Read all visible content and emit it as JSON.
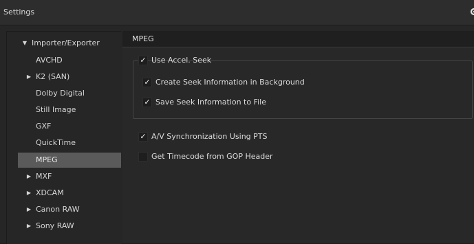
{
  "window": {
    "title": "Settings",
    "settings_icon": "gear-icon"
  },
  "tree": {
    "items": [
      {
        "label": "Importer/Exporter",
        "expandable": true,
        "expanded": true,
        "level": 0
      },
      {
        "label": "AVCHD",
        "expandable": false,
        "level": 1
      },
      {
        "label": "K2 (SAN)",
        "expandable": true,
        "expanded": false,
        "level": 1
      },
      {
        "label": "Dolby Digital",
        "expandable": false,
        "level": 1
      },
      {
        "label": "Still Image",
        "expandable": false,
        "level": 1
      },
      {
        "label": "GXF",
        "expandable": false,
        "level": 1
      },
      {
        "label": "QuickTime",
        "expandable": false,
        "level": 1
      },
      {
        "label": "MPEG",
        "expandable": false,
        "level": 1,
        "selected": true
      },
      {
        "label": "MXF",
        "expandable": true,
        "expanded": false,
        "level": 1
      },
      {
        "label": "XDCAM",
        "expandable": true,
        "expanded": false,
        "level": 1
      },
      {
        "label": "Canon RAW",
        "expandable": true,
        "expanded": false,
        "level": 1
      },
      {
        "label": "Sony RAW",
        "expandable": true,
        "expanded": false,
        "level": 1
      }
    ]
  },
  "panel": {
    "title": "MPEG",
    "options": {
      "use_accel_seek": {
        "label": "Use Accel. Seek",
        "checked": true
      },
      "create_seek_info_bg": {
        "label": "Create Seek Information in Background",
        "checked": true
      },
      "save_seek_info_file": {
        "label": "Save Seek Information to File",
        "checked": true
      },
      "av_sync_pts": {
        "label": "A/V Synchronization Using PTS",
        "checked": true
      },
      "timecode_gop": {
        "label": "Get Timecode from GOP Header",
        "checked": false
      }
    }
  },
  "colors": {
    "background": "#262626",
    "titlebar": "#2d2d2d",
    "selection": "#5a5a5a",
    "header": "#1f1f1f",
    "text": "#dcdcdc"
  }
}
